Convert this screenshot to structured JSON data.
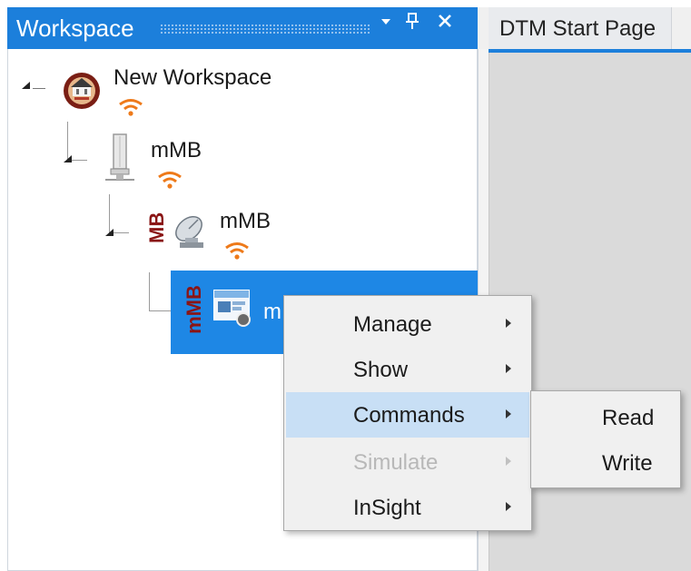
{
  "workspace_panel": {
    "title": "Workspace",
    "buttons": {
      "dropdown": "▾",
      "pin": "pin-icon",
      "close": "✕"
    }
  },
  "tabs": [
    {
      "label": "DTM Start Page"
    }
  ],
  "tree": {
    "nodes": [
      {
        "label": "New Workspace",
        "icon": "workspace-icon",
        "status_icon": "wifi-icon"
      },
      {
        "label": "mMB",
        "icon": "device-tower-icon",
        "status_icon": "wifi-icon"
      },
      {
        "label": "mMB",
        "prefix": "MB",
        "icon": "satellite-dish-icon",
        "status_icon": "wifi-icon"
      },
      {
        "label": "m",
        "prefix": "mMB",
        "icon": "dtm-module-icon",
        "selected": true
      }
    ]
  },
  "context_menu": {
    "items": [
      {
        "label": "Manage",
        "has_submenu": true,
        "enabled": true
      },
      {
        "label": "Show",
        "has_submenu": true,
        "enabled": true
      },
      {
        "label": "Commands",
        "has_submenu": true,
        "enabled": true,
        "highlighted": true
      },
      {
        "label": "Simulate",
        "has_submenu": true,
        "enabled": false
      },
      {
        "label": "InSight",
        "has_submenu": true,
        "enabled": true
      }
    ]
  },
  "submenu": {
    "items": [
      {
        "label": "Read"
      },
      {
        "label": "Write"
      }
    ]
  },
  "colors": {
    "accent": "#1c7fdb",
    "selection": "#1e87e5",
    "menu_highlight": "#c8dff5",
    "wifi": "#ee7a1a",
    "mb_text": "#8a1515"
  }
}
